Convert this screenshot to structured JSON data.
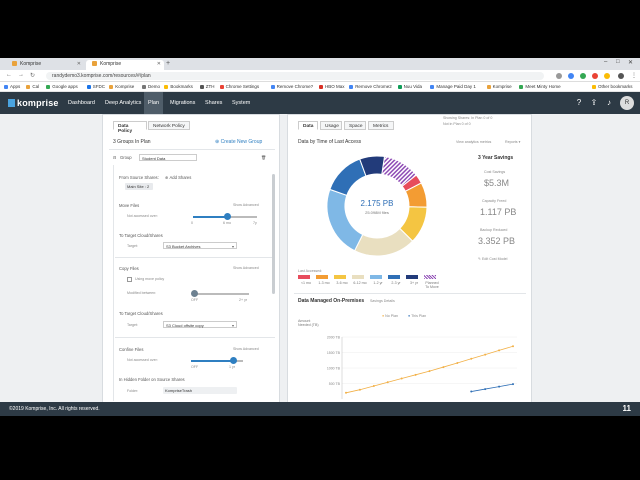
{
  "browser": {
    "tabs": [
      {
        "label": "Komprise",
        "active": false
      },
      {
        "label": "Komprise",
        "active": true
      }
    ],
    "url": "randydemo3.komprise.com/resources/#/plan",
    "bookmarks": [
      "Apps",
      "Cal",
      "Google apps",
      "SFDC",
      "Komprise",
      "Demo",
      "Bookmarks",
      "ZTH",
      "Chrome Settings",
      "Remove Chrome?",
      "HBO Max",
      "Remove Chrome2",
      "Nuu Vida",
      "Manage Paid Day 1",
      "Komprise",
      "Meet Minty Home",
      "Other bookmarks"
    ]
  },
  "app": {
    "logo": "komprise",
    "nav": [
      "Dashboard",
      "Deep Analytics",
      "Plan",
      "Migrations",
      "Shares",
      "System"
    ],
    "active_nav": "Plan",
    "avatar": "R"
  },
  "left": {
    "tabs": [
      "Data Policy",
      "Network Policy"
    ],
    "groups_label": "3 Groups In Plan",
    "create_group": "Create New Group",
    "group_name_label": "Group",
    "group_name_value": "Student Data",
    "from_source": "From Source Shares:",
    "add_shares": "Add Shares",
    "share_chip": "Main Site : 2",
    "move_files": "Move Files",
    "show_advanced": "Show Advanced",
    "not_accessed": "Not accessed over:",
    "move_value": "6 mo",
    "move_min": "0",
    "move_max": "7y",
    "to_target": "To Target Cloud/Shares",
    "target_label": "Target:",
    "move_target": "S3 Bucket Archives",
    "copy_files": "Copy Files",
    "using_move_policy": "Using move policy",
    "modified_between": "Modified between:",
    "copy_min": "OFF",
    "copy_max": "2+ yr",
    "copy_target": "S3 Cloud offsite copy",
    "confine_files": "Confine Files",
    "confine_value": "1 yr",
    "confine_min": "OFF",
    "hidden_folder": "In Hidden Folder on Source Shares",
    "folder_label": "Folder:",
    "folder_value": "KompriseTrash"
  },
  "right": {
    "tabs": [
      "Data",
      "Usage",
      "Space",
      "Metrics"
    ],
    "showing": "Showing Shares: In Plan 0 of 0",
    "not_in_plan": "Not in Plan 0 of 0",
    "chart_title": "Data by Time of Last Access",
    "analytics_link": "View analytics metrics",
    "reports": "Reports",
    "donut_value": "2.175 PB",
    "donut_files": "25.098M files",
    "savings_title": "3 Year Savings",
    "cost_label": "Cost Savings",
    "cost_value": "$5.3M",
    "capacity_label": "Capacity Freed",
    "capacity_value": "1.117 PB",
    "backup_label": "Backup Reduced",
    "backup_value": "3.352 PB",
    "edit_cost": "Edit Cost Model",
    "last_accessed": "Last Accessed:",
    "legend_labels": [
      "<1 mo",
      "1-3 mo",
      "3-6 mo",
      "6-12 mo",
      "1-2 yr",
      "2-3 yr",
      "3+ yr",
      "Planned To Move"
    ],
    "managed_title": "Data Managed On-Premises",
    "savings_details": "Savings Details",
    "no_plan": "No Plan",
    "this_plan": "This Plan",
    "y_label": "Amount Needed (TB)",
    "y_ticks": [
      "2000 TB",
      "1500 TB",
      "1000 TB",
      "500 TB"
    ]
  },
  "footer": {
    "copyright": "©2019 Komprise, Inc. All rights reserved.",
    "page": "11"
  },
  "colors": {
    "nav_bg": "#2d3a45",
    "accent": "#2f7fc1",
    "donut": [
      "#e74c5c",
      "#f39c33",
      "#f4c542",
      "#e9dfc0",
      "#7fb8e6",
      "#2f6fb6",
      "#223b7a",
      "#8e4bb5"
    ]
  },
  "chart_data": {
    "type": "line",
    "title": "Data Managed On-Premises",
    "ylabel": "Amount Needed (TB)",
    "series": [
      {
        "name": "No Plan",
        "values": [
          200,
          300,
          420,
          540,
          660,
          780,
          900,
          1030,
          1160,
          1300,
          1430,
          1570,
          1700
        ]
      },
      {
        "name": "This Plan",
        "values": [
          null,
          null,
          null,
          null,
          null,
          null,
          null,
          null,
          null,
          240,
          320,
          400,
          480
        ]
      }
    ],
    "ylim": [
      0,
      2000
    ]
  },
  "donut_data": {
    "type": "pie",
    "title": "Data by Time of Last Access",
    "categories": [
      "<1 mo",
      "1-3 mo",
      "3-6 mo",
      "6-12 mo",
      "1-2 yr",
      "2-3 yr",
      "3+ yr",
      "Planned To Move"
    ],
    "values": [
      3,
      8,
      12,
      20,
      23,
      14,
      8,
      12
    ]
  }
}
